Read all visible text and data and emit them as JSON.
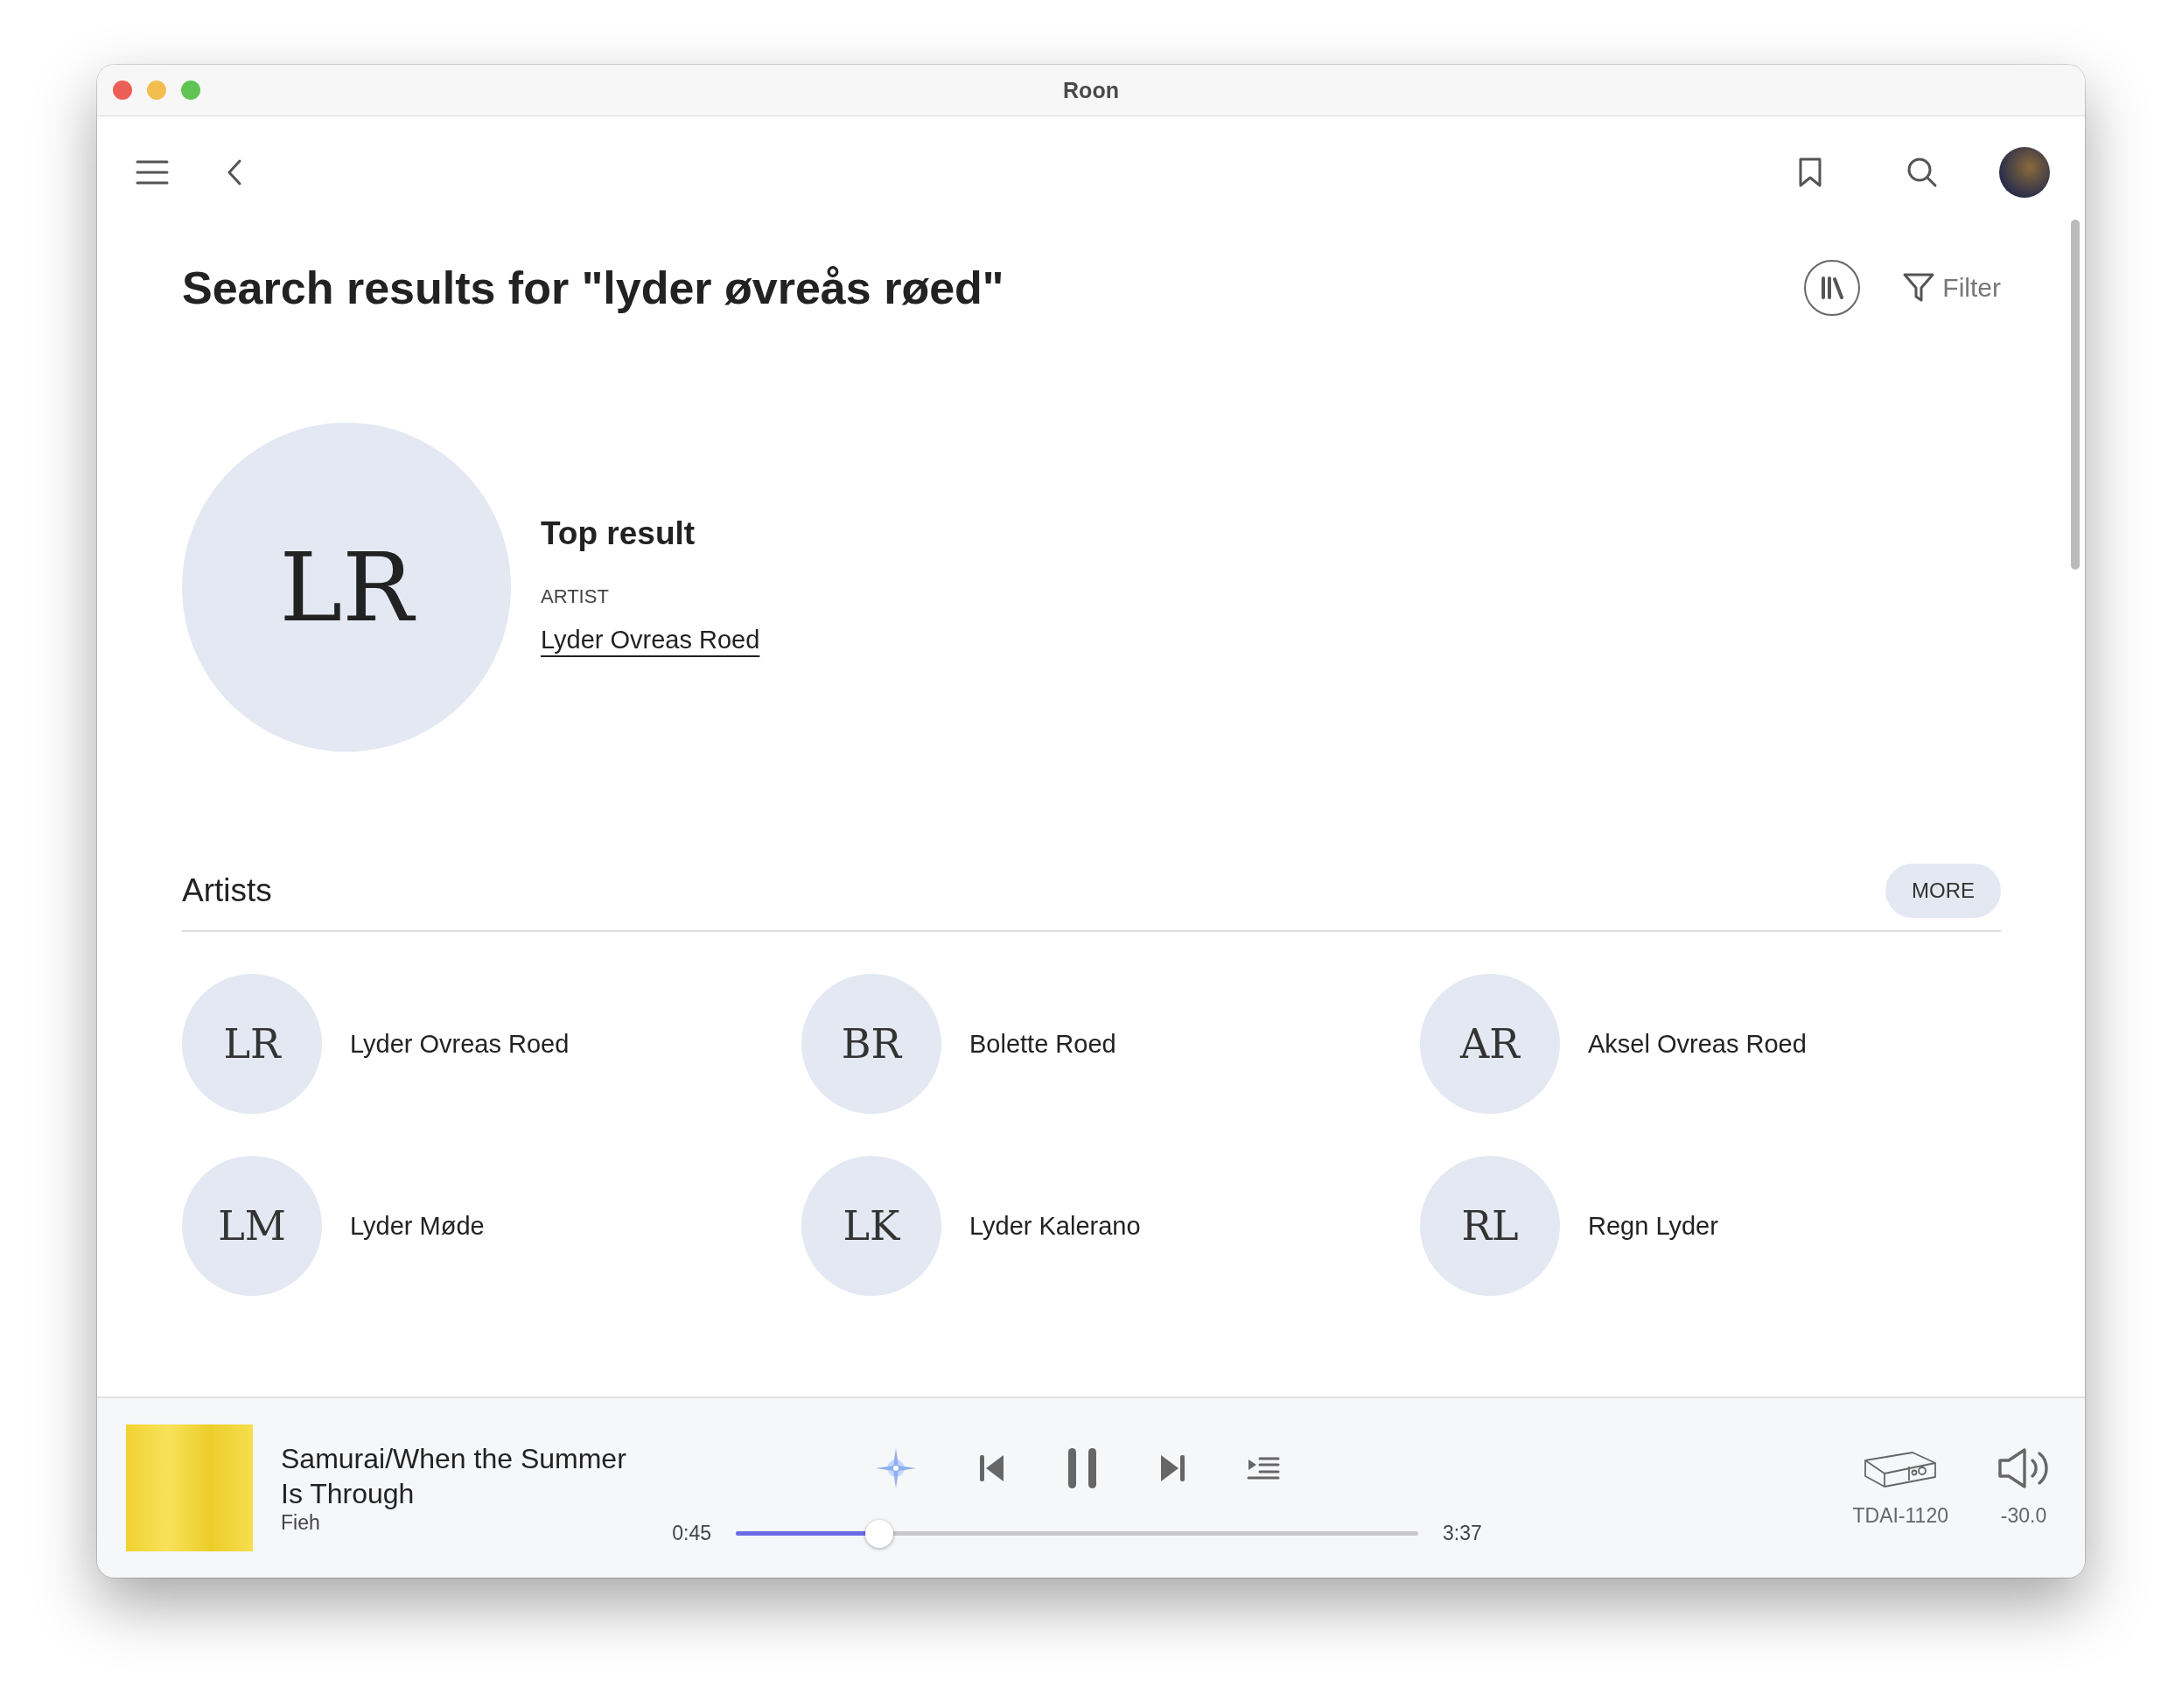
{
  "window": {
    "title": "Roon"
  },
  "page": {
    "title": "Search results for \"lyder øvreås røed\"",
    "filter_label": "Filter"
  },
  "top_result": {
    "heading": "Top result",
    "initials": "LR",
    "type": "ARTIST",
    "name": "Lyder Ovreas Roed"
  },
  "artists": {
    "heading": "Artists",
    "more": "MORE",
    "items": [
      {
        "initials": "LR",
        "name": "Lyder Ovreas Roed"
      },
      {
        "initials": "BR",
        "name": "Bolette Roed"
      },
      {
        "initials": "AR",
        "name": "Aksel Ovreas Roed"
      },
      {
        "initials": "LM",
        "name": "Lyder Møde"
      },
      {
        "initials": "LK",
        "name": "Lyder Kalerano"
      },
      {
        "initials": "RL",
        "name": "Regn Lyder"
      }
    ]
  },
  "player": {
    "title_line_1": "Samurai/When the Summer",
    "title_line_2": "Is Through",
    "artist": "Fieh",
    "elapsed": "0:45",
    "duration": "3:37",
    "level": 0.21,
    "playing": true,
    "zone": "TDAI-1120",
    "volume": "-30.0"
  }
}
